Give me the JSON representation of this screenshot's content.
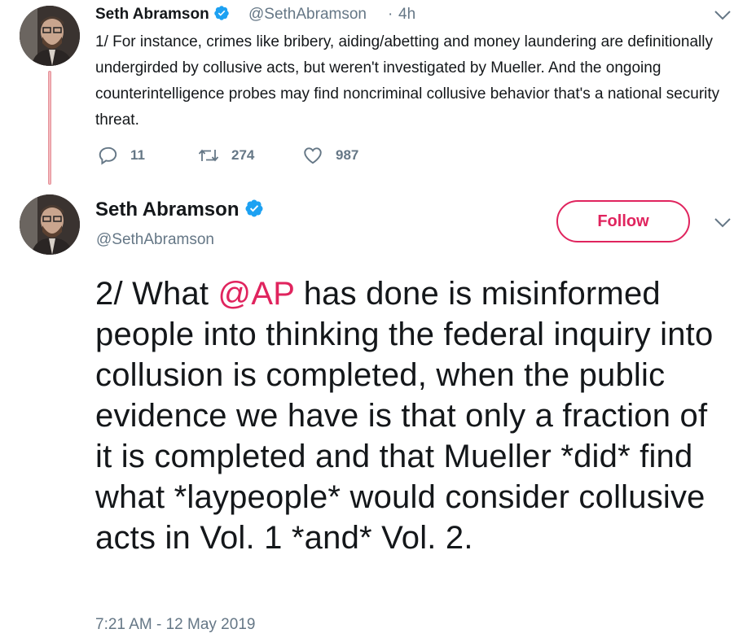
{
  "tweet1": {
    "name": "Seth Abramson",
    "handle": "@SethAbramson",
    "dot": "·",
    "time": "4h",
    "text": "1/  For instance, crimes like bribery, aiding/abetting and money laundering are definitionally undergirded by collusive acts, but weren't investigated by Mueller. And the ongoing counterintelligence probes may find noncriminal collusive behavior that's a national security threat.",
    "replies": "11",
    "retweets": "274",
    "likes": "987"
  },
  "tweet2": {
    "name": "Seth Abramson",
    "handle": "@SethAbramson",
    "follow_label": "Follow",
    "text_before": "2/ What ",
    "mention": "@AP",
    "text_after": " has done is misinformed people into thinking the federal inquiry into collusion is completed, when the public evidence we have is that only a fraction of it is completed and that Mueller *did* find what *laypeople* would consider collusive acts in Vol. 1 *and* Vol. 2.",
    "timestamp": "7:21 AM - 12 May 2019"
  },
  "colors": {
    "accent": "#e0245e",
    "secondary_text": "#657786",
    "verified": "#1da1f2",
    "thread_line": "#f3b7bc"
  },
  "icons": {
    "reply": "reply-icon",
    "retweet": "retweet-icon",
    "like": "heart-icon",
    "verified": "verified-badge-icon",
    "menu": "chevron-down-icon"
  }
}
